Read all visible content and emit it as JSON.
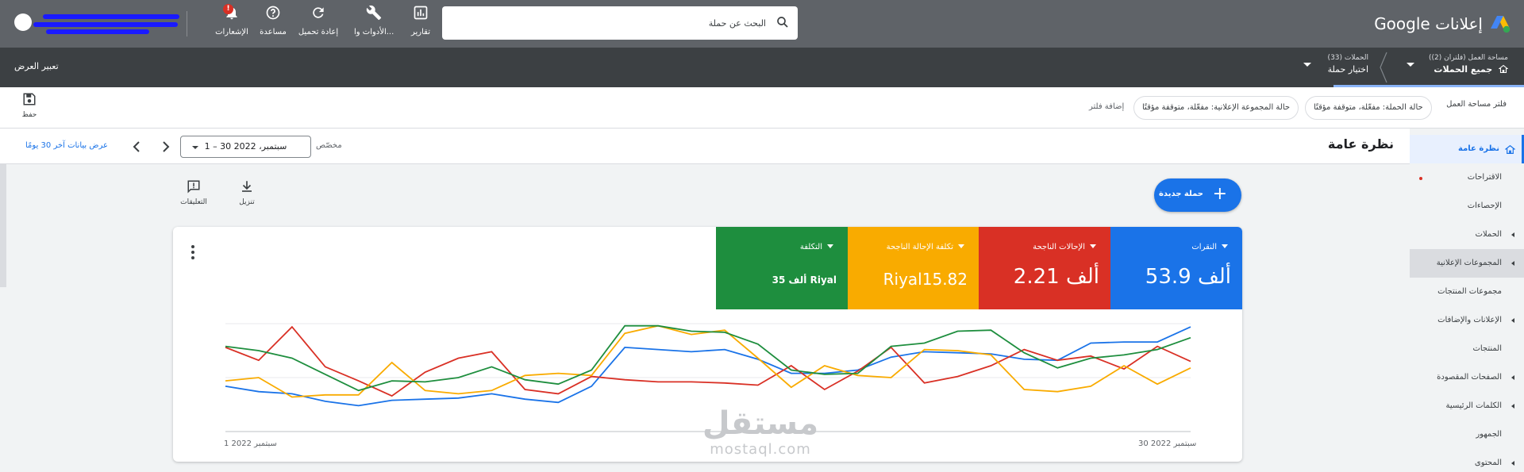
{
  "topbar": {
    "brand": "إعلانات Google",
    "search_placeholder": "البحث عن حملة",
    "tools": {
      "reports": "تقارير",
      "tools": "الأدوات وا...",
      "refresh": "إعادة تحميل",
      "help": "مساعدة",
      "notifications": "الإشعارات",
      "notifications_count": "!"
    }
  },
  "navbar": {
    "workspace_label": "مساحة العمل (فلتران (2))",
    "workspace_value": "جميع الحملات",
    "campaigns_label": "الحملات (33)",
    "campaigns_value": "اختيار حملة",
    "view_link": "تعبير العرض"
  },
  "filterbar": {
    "save": "حفظ",
    "workspace_filter": "فلتر مساحة العمل",
    "chips": [
      "حالة الحملة: مفعّلة، متوقفة مؤقتًا",
      "حالة المجموعة الإعلانية: مفعّلة، متوقفة مؤقتًا"
    ],
    "add_filter": "إضافة فلتر"
  },
  "sidebar": {
    "items": [
      {
        "label": "نظرة عامة"
      },
      {
        "label": "الاقتراحات"
      },
      {
        "label": "الإحصاءات"
      },
      {
        "label": "الحملات"
      },
      {
        "label": "المجموعات الإعلانية"
      },
      {
        "label": "مجموعات المنتجات"
      },
      {
        "label": "الإعلانات والإضافات"
      },
      {
        "label": "المنتجات"
      },
      {
        "label": "الصفحات المقصودة"
      },
      {
        "label": "الكلمات الرئيسية"
      },
      {
        "label": "الجمهور"
      },
      {
        "label": "المحتوى"
      }
    ]
  },
  "main": {
    "title": "نظرة عامة",
    "date_range": "1 – 30 سبتمبر، 2022",
    "custom": "مخصّص",
    "last_30": "عرض بيانات آخر 30 يومًا",
    "download": "تنزيل",
    "feedback": "التعليقات",
    "new_campaign": "حملة جديدة"
  },
  "metrics": [
    {
      "label": "النقرات",
      "value": "53.9 ألف",
      "color": "#1a73e8"
    },
    {
      "label": "الإحالات الناجحة",
      "value": "2.21 ألف",
      "color": "#d93025"
    },
    {
      "label": "تكلفة الإحالة الناجحة",
      "value": "Riyal15.82",
      "color": "#f9ab00"
    },
    {
      "label": "التكلفة",
      "value": "35 ألف Riyal",
      "color": "#1e8e3e"
    }
  ],
  "chart_data": {
    "type": "line",
    "x_start_label": "1 سبتمبر 2022",
    "x_end_label": "30 سبتمبر 2022",
    "grid": true,
    "series": [
      {
        "color": "#1a73e8",
        "values": [
          0.42,
          0.37,
          0.35,
          0.28,
          0.24,
          0.29,
          0.3,
          0.31,
          0.35,
          0.3,
          0.27,
          0.42,
          0.78,
          0.76,
          0.74,
          0.76,
          0.67,
          0.54,
          0.54,
          0.57,
          0.69,
          0.74,
          0.73,
          0.72,
          0.67,
          0.66,
          0.82,
          0.83,
          0.83,
          0.97
        ]
      },
      {
        "color": "#d93025",
        "values": [
          0.78,
          0.66,
          0.97,
          0.6,
          0.47,
          0.33,
          0.55,
          0.68,
          0.74,
          0.39,
          0.35,
          0.51,
          0.48,
          0.46,
          0.46,
          0.45,
          0.43,
          0.61,
          0.39,
          0.56,
          0.78,
          0.45,
          0.51,
          0.61,
          0.76,
          0.66,
          0.7,
          0.58,
          0.79,
          0.65
        ]
      },
      {
        "color": "#f9ab00",
        "values": [
          0.47,
          0.5,
          0.32,
          0.34,
          0.34,
          0.64,
          0.38,
          0.35,
          0.38,
          0.52,
          0.54,
          0.52,
          0.91,
          0.98,
          0.9,
          0.94,
          0.68,
          0.41,
          0.61,
          0.52,
          0.5,
          0.76,
          0.75,
          0.71,
          0.39,
          0.37,
          0.42,
          0.61,
          0.44,
          0.59
        ]
      },
      {
        "color": "#1e8e3e",
        "values": [
          0.79,
          0.75,
          0.68,
          0.53,
          0.38,
          0.47,
          0.46,
          0.5,
          0.6,
          0.48,
          0.44,
          0.57,
          0.98,
          0.98,
          0.93,
          0.92,
          0.81,
          0.57,
          0.53,
          0.54,
          0.79,
          0.82,
          0.93,
          0.94,
          0.73,
          0.59,
          0.68,
          0.71,
          0.76,
          0.87
        ]
      }
    ]
  },
  "watermark": {
    "ar": "مستقل",
    "en": "mostaql.com"
  }
}
